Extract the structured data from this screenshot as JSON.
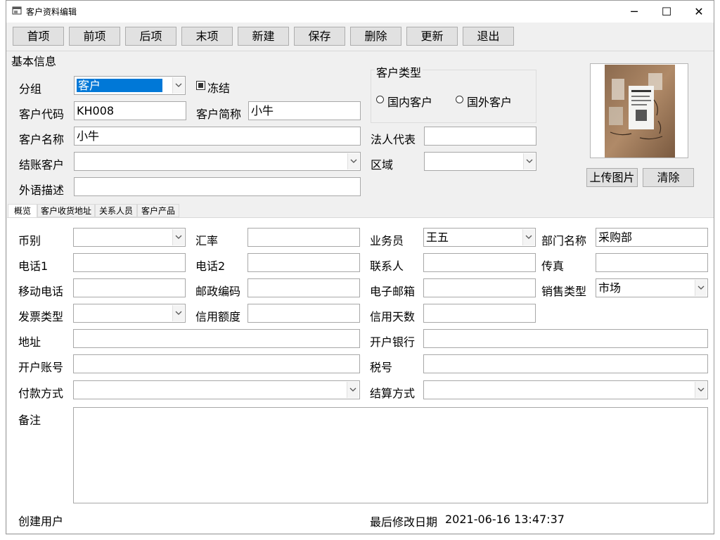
{
  "window": {
    "title": "客户资料编辑",
    "min_glyph": "─",
    "max_glyph": "☐",
    "close_glyph": "✕"
  },
  "toolbar": [
    "首项",
    "前项",
    "后项",
    "末项",
    "新建",
    "保存",
    "删除",
    "更新",
    "退出"
  ],
  "basic": {
    "section_title": "基本信息",
    "group_label": "分组",
    "group_value": "客户",
    "frozen_label": "冻结",
    "code_label": "客户代码",
    "code_value": "KH008",
    "short_label": "客户简称",
    "short_value": "小牛",
    "name_label": "客户名称",
    "name_value": "小牛",
    "settle_customer_label": "结账客户",
    "foreign_desc_label": "外语描述",
    "type_title": "客户类型",
    "type_domestic": "国内客户",
    "type_foreign": "国外客户",
    "legal_rep_label": "法人代表",
    "region_label": "区域",
    "upload_label": "上传图片",
    "clear_label": "清除"
  },
  "tabs": [
    "概览",
    "客户收货地址",
    "关系人员",
    "客户产品"
  ],
  "overview": {
    "currency_label": "币别",
    "rate_label": "汇率",
    "salesman_label": "业务员",
    "salesman_value": "王五",
    "dept_label": "部门名称",
    "dept_value": "采购部",
    "phone1_label": "电话1",
    "phone2_label": "电话2",
    "contact_label": "联系人",
    "fax_label": "传真",
    "mobile_label": "移动电话",
    "postcode_label": "邮政编码",
    "email_label": "电子邮箱",
    "sales_type_label": "销售类型",
    "sales_type_value": "市场",
    "invoice_type_label": "发票类型",
    "credit_limit_label": "信用额度",
    "credit_days_label": "信用天数",
    "address_label": "地址",
    "bank_label": "开户银行",
    "account_label": "开户账号",
    "tax_label": "税号",
    "payment_label": "付款方式",
    "settle_method_label": "结算方式",
    "remark_label": "备注",
    "creator_label": "创建用户",
    "modified_label": "最后修改日期",
    "modified_value": "2021-06-16 13:47:37"
  }
}
